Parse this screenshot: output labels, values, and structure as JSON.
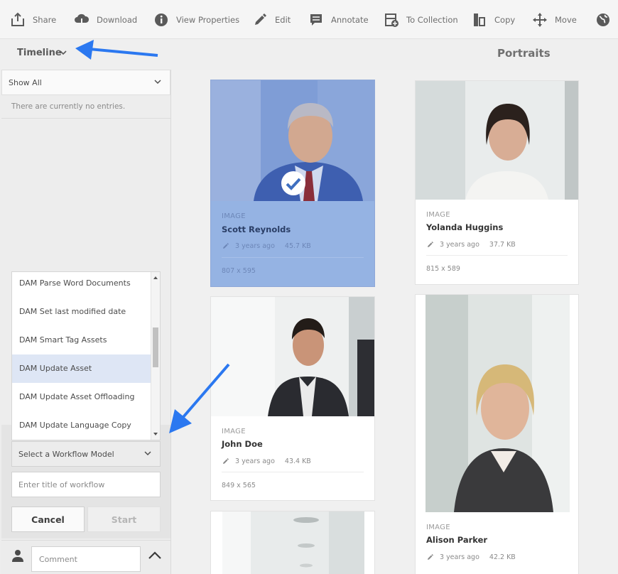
{
  "toolbar": {
    "items": [
      {
        "label": "Share",
        "icon": "share-icon"
      },
      {
        "label": "Download",
        "icon": "download-icon"
      },
      {
        "label": "View Properties",
        "icon": "info-icon"
      },
      {
        "label": "Edit",
        "icon": "pencil-icon"
      },
      {
        "label": "Annotate",
        "icon": "annotate-icon"
      },
      {
        "label": "To Collection",
        "icon": "collection-add-icon"
      },
      {
        "label": "Copy",
        "icon": "copy-icon"
      },
      {
        "label": "Move",
        "icon": "move-icon"
      },
      {
        "label": "",
        "icon": "globe-icon"
      }
    ]
  },
  "rail": {
    "title": "Timeline",
    "filter": "Show All",
    "empty": "There are currently no entries.",
    "workflows": [
      "DAM Parse Word Documents",
      "DAM Set last modified date",
      "DAM Smart Tag Assets",
      "DAM Update Asset",
      "DAM Update Asset Offloading",
      "DAM Update Language Copy"
    ],
    "selected_workflow": "DAM Update Asset",
    "model_placeholder": "Select a Workflow Model",
    "title_placeholder": "Enter title of workflow",
    "cancel": "Cancel",
    "start": "Start",
    "comment_placeholder": "Comment"
  },
  "page": {
    "title": "Portraits"
  },
  "cards": [
    {
      "type": "IMAGE",
      "name": "Scott Reynolds",
      "age": "3 years ago",
      "size": "45.7 KB",
      "dims": "807 x 595",
      "selected": true
    },
    {
      "type": "IMAGE",
      "name": "Yolanda Huggins",
      "age": "3 years ago",
      "size": "37.7 KB",
      "dims": "815 x 589",
      "selected": false
    },
    {
      "type": "IMAGE",
      "name": "John Doe",
      "age": "3 years ago",
      "size": "43.4 KB",
      "dims": "849 x 565",
      "selected": false
    },
    {
      "type": "IMAGE",
      "name": "Alison Parker",
      "age": "3 years ago",
      "size": "42.2 KB",
      "selected": false
    }
  ],
  "colors": {
    "selection": "#95b3e3",
    "annotation_arrow": "#2b78f0"
  }
}
